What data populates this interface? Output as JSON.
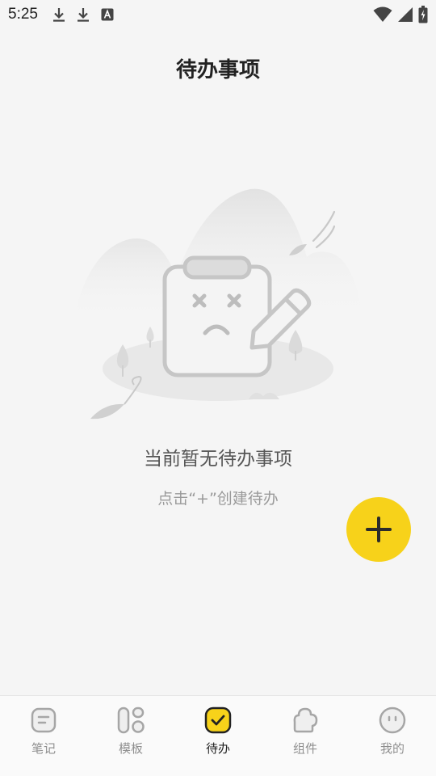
{
  "status_bar": {
    "time": "5:25",
    "icons": [
      "download-icon",
      "download-icon",
      "text-a-icon",
      "wifi-icon",
      "signal-icon",
      "battery-icon"
    ]
  },
  "header": {
    "title": "待办事项"
  },
  "empty_state": {
    "title": "当前暂无待办事项",
    "hint": "点击“+”创建待办"
  },
  "fab": {
    "icon": "plus-icon",
    "color": "#f7d21a"
  },
  "bottom_nav": {
    "items": [
      {
        "label": "笔记",
        "icon": "note-icon",
        "active": false
      },
      {
        "label": "模板",
        "icon": "template-icon",
        "active": false
      },
      {
        "label": "待办",
        "icon": "todo-check-icon",
        "active": true
      },
      {
        "label": "组件",
        "icon": "widget-icon",
        "active": false
      },
      {
        "label": "我的",
        "icon": "profile-face-icon",
        "active": false
      }
    ],
    "active_color": "#f7d21a"
  }
}
